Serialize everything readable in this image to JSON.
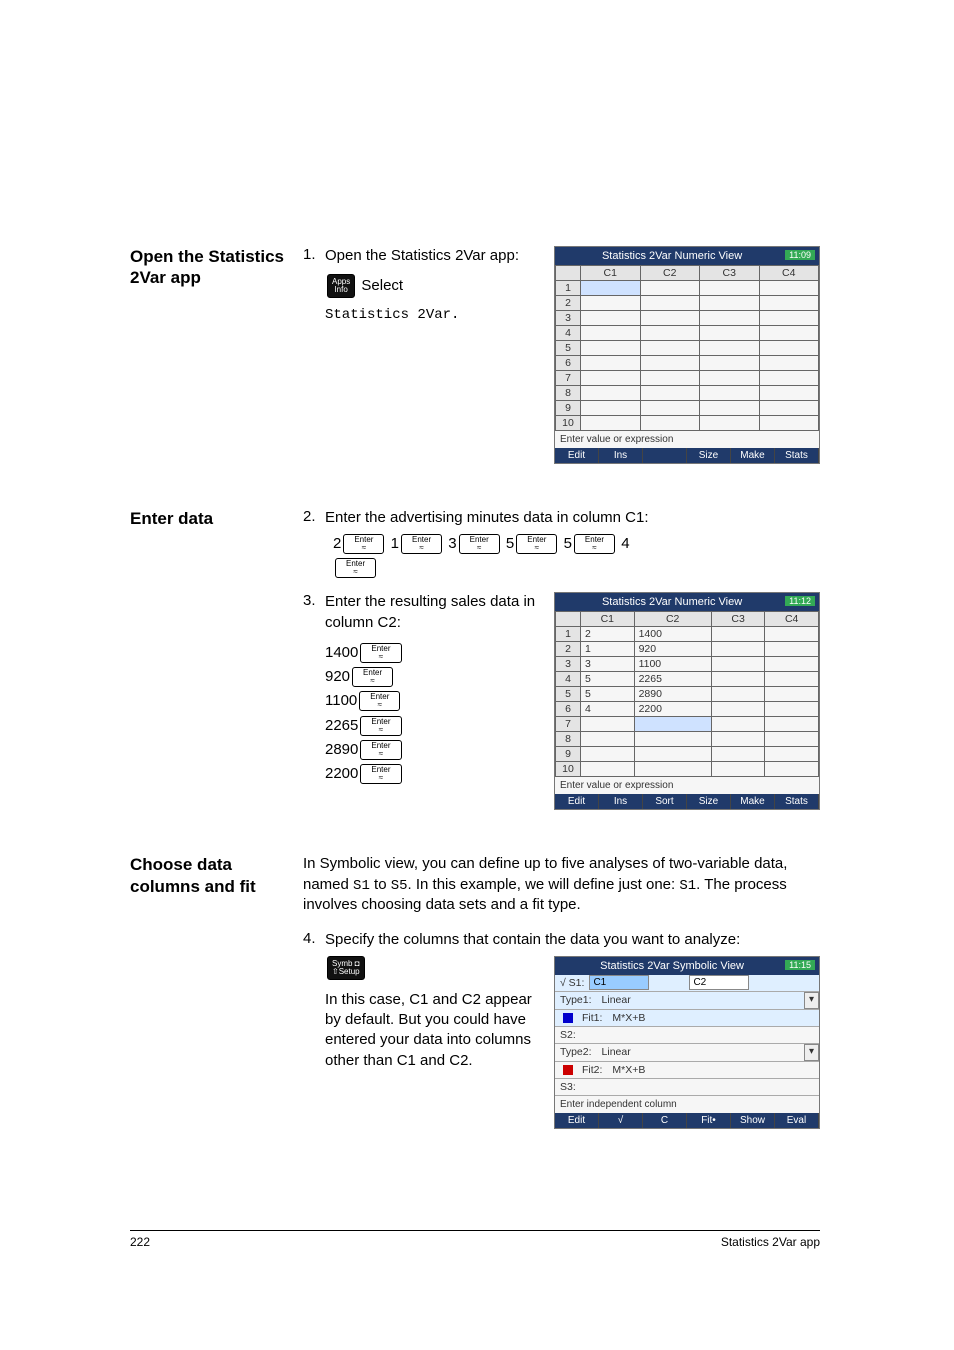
{
  "headings": {
    "open": "Open the Statistics 2Var app",
    "enter": "Enter data",
    "choose": "Choose data columns and fit"
  },
  "step1": {
    "num": "1.",
    "text": "Open the Statistics 2Var app:",
    "sub1": " Select ",
    "sub2": "Statistics 2Var",
    "sub3": "."
  },
  "step2": {
    "num": "2.",
    "text": "Enter the advertising minutes data in column C1:",
    "seq": [
      "2",
      "1",
      "3",
      "5",
      "5",
      "4"
    ]
  },
  "step3": {
    "num": "3.",
    "text": "Enter the resulting sales data in column C2:",
    "vals": [
      "1400",
      "920",
      "1100",
      "2265",
      "2890",
      "2200"
    ]
  },
  "choose_body": "In Symbolic view, you can define up to five analyses of two-variable data, named S1 to S5. In this example, we will define just one: S1. The process involves choosing data sets and a fit type.",
  "step4": {
    "num": "4.",
    "text": "Specify the columns that contain the data you want to analyze:",
    "sub": "In this case, C1 and C2 appear by default. But you could have entered your data into columns other than C1 and C2."
  },
  "keys": {
    "enter_top": "Enter",
    "enter_bot": "≈",
    "apps_top": "Apps",
    "apps_bot": "Info",
    "symb_top": "Symb ◘",
    "symb_bot": "⇧Setup"
  },
  "calc_numeric_title": "Statistics 2Var Numeric View",
  "calc_symb_title": "Statistics 2Var Symbolic View",
  "calc_time1": "11:09",
  "calc_time2": "11:12",
  "calc_time3": "11:15",
  "cols": [
    "C1",
    "C2",
    "C3",
    "C4"
  ],
  "data_c1": [
    "2",
    "1",
    "3",
    "5",
    "5",
    "4"
  ],
  "data_c2": [
    "1400",
    "920",
    "1100",
    "2265",
    "2890",
    "2200"
  ],
  "hint": "Enter value or expression",
  "softkeys_num1": [
    "Edit",
    "Ins",
    "",
    "Size",
    "Make",
    "Stats"
  ],
  "softkeys_num2": [
    "Edit",
    "Ins",
    "Sort",
    "Size",
    "Make",
    "Stats"
  ],
  "softkeys_sym": [
    "Edit",
    "√",
    "C",
    "Fit•",
    "Show",
    "Eval"
  ],
  "symb": {
    "s1a": "C1",
    "s1b": "C2",
    "type1_lbl": "Type1:",
    "type1_val": "Linear",
    "fit1_lbl": "Fit1:",
    "fit1_val": "M*X+B",
    "s2_lbl": "S2:",
    "type2_lbl": "Type2:",
    "type2_val": "Linear",
    "fit2_lbl": "Fit2:",
    "fit2_val": "M*X+B",
    "s3_lbl": "S3:",
    "hint": "Enter independent column",
    "s1_lbl": "√ S1:"
  },
  "footer": {
    "page": "222",
    "label": "Statistics 2Var app"
  }
}
